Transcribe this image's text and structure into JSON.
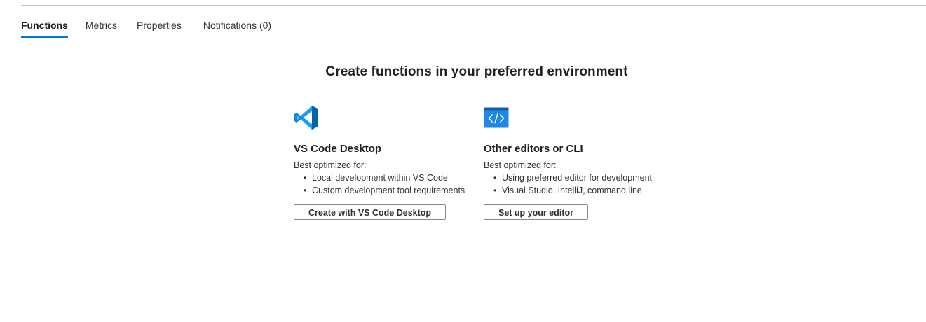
{
  "tabs": [
    {
      "label": "Functions",
      "active": true
    },
    {
      "label": "Metrics",
      "active": false
    },
    {
      "label": "Properties",
      "active": false
    },
    {
      "label": "Notifications (0)",
      "active": false
    }
  ],
  "heading": "Create functions in your preferred environment",
  "cards": [
    {
      "icon": "vscode-icon",
      "title": "VS Code Desktop",
      "subtitle": "Best optimized for:",
      "bullets": [
        "Local development within VS Code",
        "Custom development tool requirements"
      ],
      "button": "Create with VS Code Desktop"
    },
    {
      "icon": "code-editor-icon",
      "title": "Other editors or CLI",
      "subtitle": "Best optimized for:",
      "bullets": [
        "Using preferred editor for development",
        "Visual Studio, IntelliJ, command line"
      ],
      "button": "Set up your editor"
    }
  ],
  "colors": {
    "accent": "#0078d4",
    "vscode_blue": "#1f9cf0",
    "vscode_dark": "#0065a9"
  }
}
